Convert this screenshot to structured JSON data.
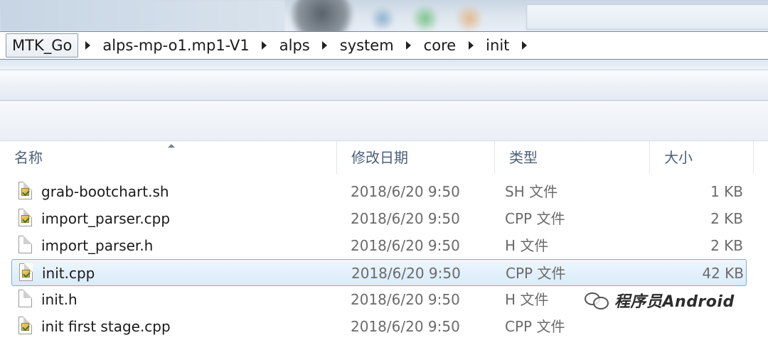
{
  "breadcrumb": {
    "items": [
      "MTK_Go",
      "alps-mp-o1.mp1-V1",
      "alps",
      "system",
      "core",
      "init"
    ]
  },
  "columns": {
    "name": "名称",
    "date": "修改日期",
    "type": "类型",
    "size": "大小"
  },
  "files": [
    {
      "name": "grab-bootchart.sh",
      "date": "2018/6/20 9:50",
      "type": "SH 文件",
      "size": "1 KB",
      "icon": "script-file-icon",
      "selected": false
    },
    {
      "name": "import_parser.cpp",
      "date": "2018/6/20 9:50",
      "type": "CPP 文件",
      "size": "2 KB",
      "icon": "cpp-file-icon",
      "selected": false
    },
    {
      "name": "import_parser.h",
      "date": "2018/6/20 9:50",
      "type": "H 文件",
      "size": "2 KB",
      "icon": "blank-file-icon",
      "selected": false
    },
    {
      "name": "init.cpp",
      "date": "2018/6/20 9:50",
      "type": "CPP 文件",
      "size": "42 KB",
      "icon": "cpp-file-icon",
      "selected": true
    },
    {
      "name": "init.h",
      "date": "2018/6/20 9:50",
      "type": "H 文件",
      "size": "",
      "icon": "blank-file-icon",
      "selected": false
    },
    {
      "name": "init first stage.cpp",
      "date": "2018/6/20 9:50",
      "type": "CPP 文件",
      "size": "",
      "icon": "cpp-file-icon",
      "selected": false
    }
  ],
  "watermark": {
    "text": "程序员Android",
    "icon": "wechat-icon"
  },
  "colors": {
    "selection_bg": "#d9ebfa",
    "selection_border": "#84acd1",
    "header_text": "#4c607a"
  }
}
